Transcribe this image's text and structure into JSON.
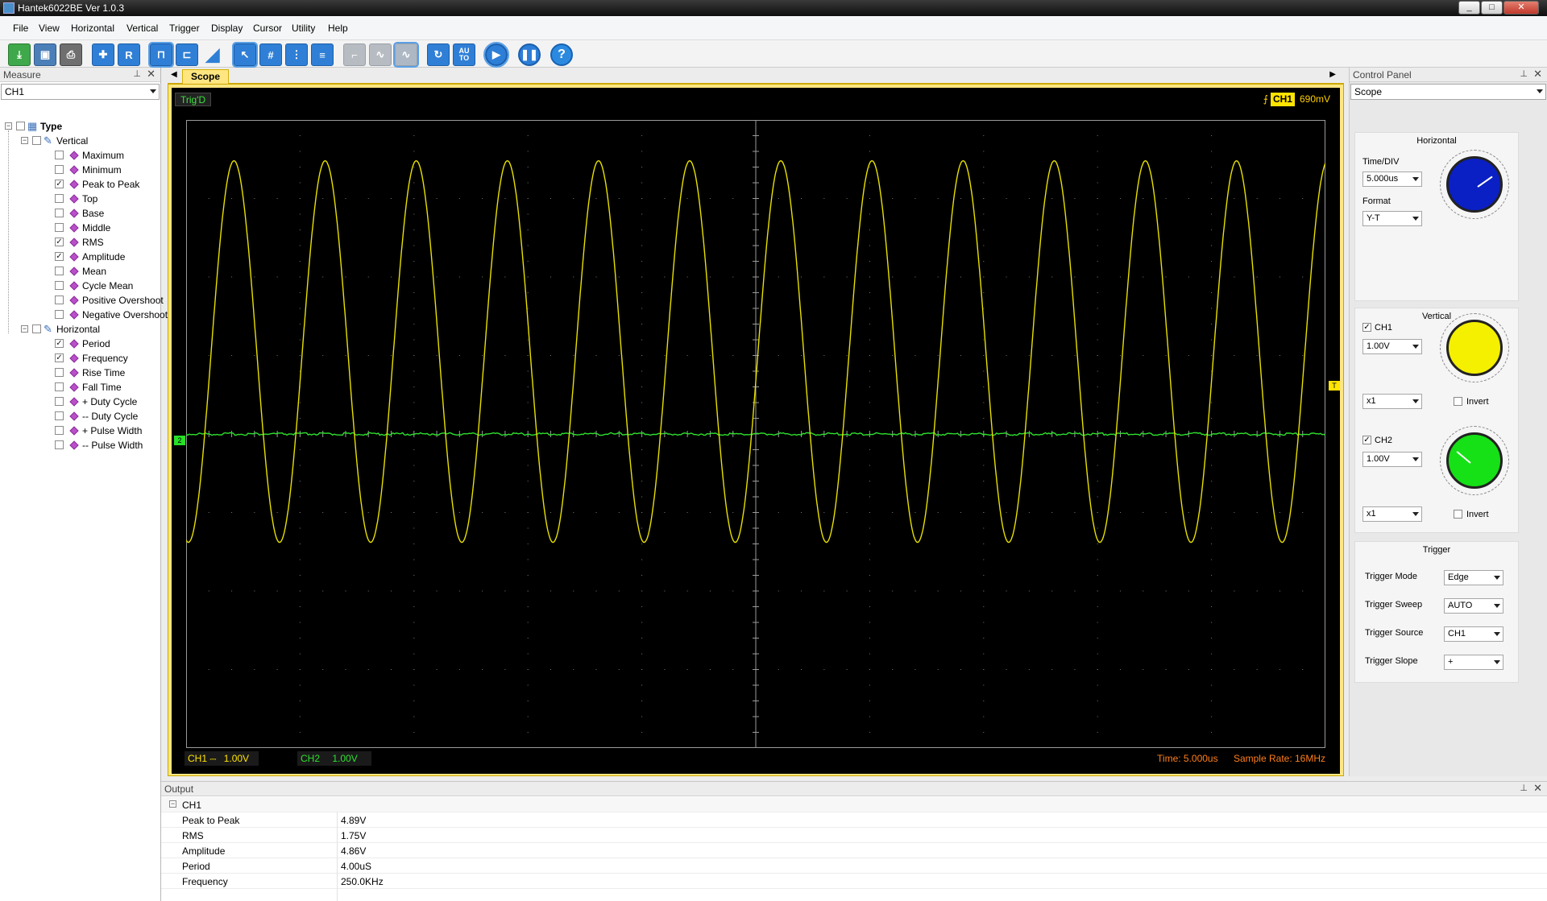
{
  "window": {
    "title": "Hantek6022BE Ver 1.0.3",
    "min": "_",
    "max": "□",
    "close": "✕"
  },
  "menu": [
    "File",
    "View",
    "Horizontal",
    "Vertical",
    "Trigger",
    "Display",
    "Cursor",
    "Utility",
    "Help"
  ],
  "toolbar": {
    "auto_label": "AU TO",
    "help_label": "?"
  },
  "measure": {
    "title": "Measure",
    "channel": "CH1",
    "tree": [
      {
        "label": "Type",
        "level": 0,
        "bold": true
      },
      {
        "label": "Vertical",
        "level": 1
      },
      {
        "label": "Maximum",
        "level": 2,
        "checked": false
      },
      {
        "label": "Minimum",
        "level": 2,
        "checked": false
      },
      {
        "label": "Peak to Peak",
        "level": 2,
        "checked": true
      },
      {
        "label": "Top",
        "level": 2,
        "checked": false
      },
      {
        "label": "Base",
        "level": 2,
        "checked": false
      },
      {
        "label": "Middle",
        "level": 2,
        "checked": false
      },
      {
        "label": "RMS",
        "level": 2,
        "checked": true
      },
      {
        "label": "Amplitude",
        "level": 2,
        "checked": true
      },
      {
        "label": "Mean",
        "level": 2,
        "checked": false
      },
      {
        "label": "Cycle Mean",
        "level": 2,
        "checked": false
      },
      {
        "label": "Positive Overshoot",
        "level": 2,
        "checked": false
      },
      {
        "label": "Negative Overshoot",
        "level": 2,
        "checked": false
      },
      {
        "label": "Horizontal",
        "level": 1
      },
      {
        "label": "Period",
        "level": 2,
        "checked": true
      },
      {
        "label": "Frequency",
        "level": 2,
        "checked": true
      },
      {
        "label": "Rise Time",
        "level": 2,
        "checked": false
      },
      {
        "label": "Fall Time",
        "level": 2,
        "checked": false
      },
      {
        "label": "+ Duty Cycle",
        "level": 2,
        "checked": false
      },
      {
        "label": "-- Duty Cycle",
        "level": 2,
        "checked": false
      },
      {
        "label": "+ Pulse Width",
        "level": 2,
        "checked": false
      },
      {
        "label": "-- Pulse Width",
        "level": 2,
        "checked": false
      }
    ]
  },
  "scope": {
    "tab": "Scope",
    "trig_status": "Trig'D",
    "trig_channel": "CH1",
    "trig_level": "690mV",
    "ch1_label": "CH1",
    "ch1_coupling": "⎓",
    "ch1_volts": "1.00V",
    "ch2_label": "CH2",
    "ch2_volts": "1.00V",
    "time": "Time: 5.000us",
    "sample_rate": "Sample Rate: 16MHz",
    "trigger_marker": "T",
    "ch2_marker": "2",
    "ch1_color": "#e8e000",
    "ch2_color": "#2fe02f",
    "waveform": {
      "cycles": 12.5,
      "amplitude_div": 2.43,
      "offset_div": 1.05,
      "phase_div_start": 0.0
    }
  },
  "output": {
    "title": "Output",
    "group": "CH1",
    "rows": [
      {
        "k": "Peak to Peak",
        "v": "4.89V"
      },
      {
        "k": "RMS",
        "v": "1.75V"
      },
      {
        "k": "Amplitude",
        "v": "4.86V"
      },
      {
        "k": "Period",
        "v": "4.00uS"
      },
      {
        "k": "Frequency",
        "v": "250.0KHz"
      }
    ]
  },
  "control": {
    "title": "Control Panel",
    "mode": "Scope",
    "horizontal": {
      "title": "Horizontal",
      "timediv_label": "Time/DIV",
      "timediv": "5.000us",
      "format_label": "Format",
      "format": "Y-T",
      "knob_color": "#0a1fc4"
    },
    "vertical": {
      "title": "Vertical",
      "ch1": {
        "label": "CH1",
        "checked": true,
        "volts": "1.00V",
        "probe": "x1",
        "invert": "Invert",
        "knob_color": "#f4f000"
      },
      "ch2": {
        "label": "CH2",
        "checked": true,
        "volts": "1.00V",
        "probe": "x1",
        "invert": "Invert",
        "knob_color": "#16e016"
      }
    },
    "trigger": {
      "title": "Trigger",
      "mode_label": "Trigger Mode",
      "mode": "Edge",
      "sweep_label": "Trigger Sweep",
      "sweep": "AUTO",
      "source_label": "Trigger Source",
      "source": "CH1",
      "slope_label": "Trigger Slope",
      "slope": "+"
    }
  }
}
